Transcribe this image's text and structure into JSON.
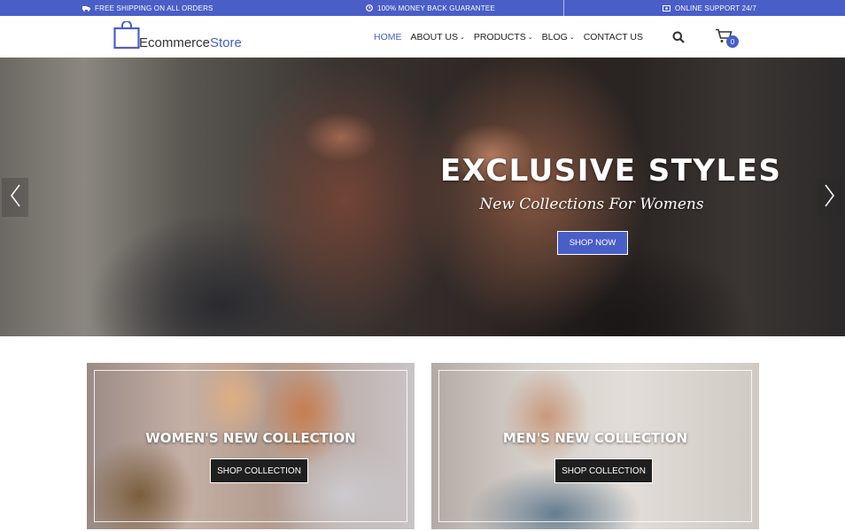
{
  "topbar": {
    "shipping": "FREE SHIPPING ON ALL ORDERS",
    "guarantee": "100% MONEY BACK GUARANTEE",
    "support": "ONLINE SUPPORT 24/7",
    "icons": [
      "truck-icon",
      "clock-icon",
      "money-icon"
    ]
  },
  "header": {
    "logo_prefix": "Ecommerce",
    "logo_suffix": "Store",
    "nav": [
      {
        "label": "HOME",
        "active": true
      },
      {
        "label": "ABOUT US",
        "dropdown": true
      },
      {
        "label": "PRODUCTS",
        "dropdown": true
      },
      {
        "label": "BLOG",
        "dropdown": true
      },
      {
        "label": "CONTACT US"
      }
    ],
    "cart_count": "0",
    "icons": [
      "search-icon",
      "cart-icon"
    ]
  },
  "hero": {
    "title": "EXCLUSIVE STYLES",
    "subtitle": "New Collections For Womens",
    "button": "SHOP NOW"
  },
  "collections": [
    {
      "title": "WOMEN'S NEW COLLECTION",
      "button": "SHOP COLLECTION"
    },
    {
      "title": "MEN'S NEW COLLECTION",
      "button": "SHOP COLLECTION"
    }
  ],
  "colors": {
    "accent": "#4a5ec7",
    "text": "#222222"
  }
}
